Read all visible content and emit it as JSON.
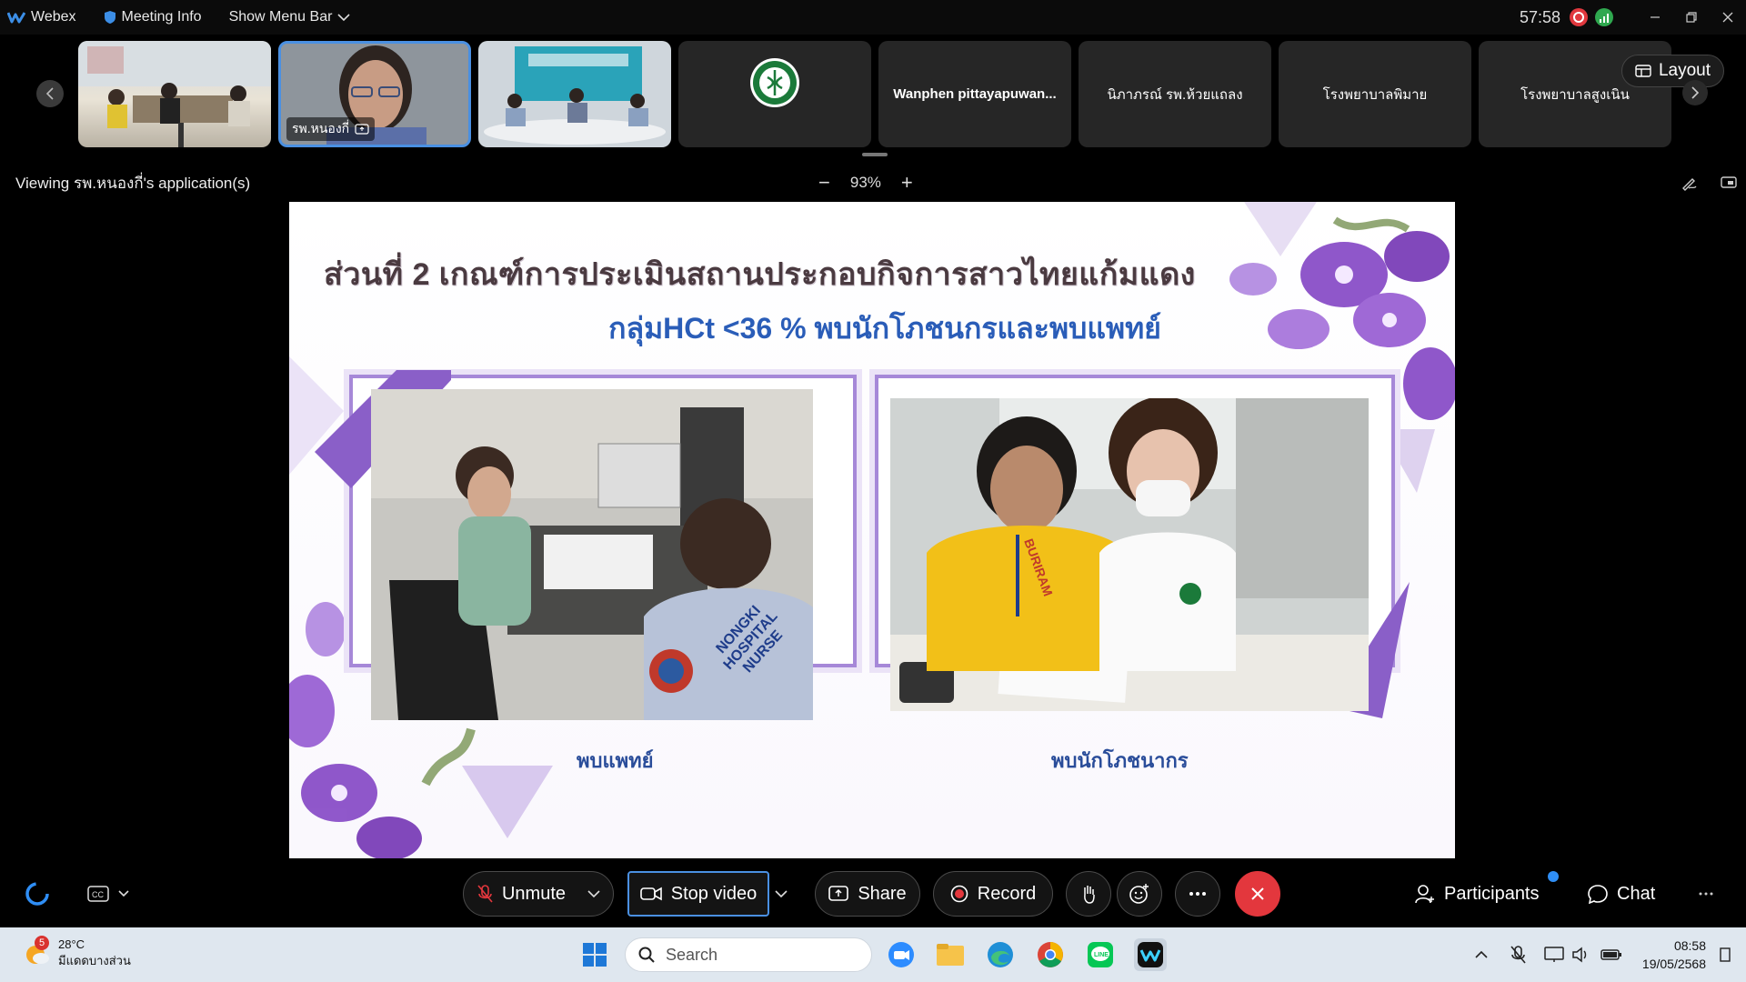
{
  "titlebar": {
    "app_name": "Webex",
    "meeting_info": "Meeting Info",
    "show_menu_bar": "Show Menu Bar",
    "timer": "57:58",
    "colors": {
      "webex_blue": "#3c8ee6",
      "record_red": "#e0383e",
      "stats_green": "#2fa84f"
    }
  },
  "filmstrip": {
    "participants": [
      {
        "name": "",
        "type": "video"
      },
      {
        "name": "รพ.หนองกี่",
        "type": "video",
        "active": true
      },
      {
        "name": "",
        "type": "video"
      },
      {
        "name": "",
        "type": "logo"
      },
      {
        "name": "Wanphen pittayapuwan...",
        "type": "name"
      },
      {
        "name": "นิภาภรณ์ รพ.ห้วยแถลง",
        "type": "name"
      },
      {
        "name": "โรงพยาบาลพิมาย",
        "type": "name"
      },
      {
        "name": "โรงพยาบาลสูงเนิน",
        "type": "name"
      }
    ],
    "layout_label": "Layout"
  },
  "viewbar": {
    "viewing_text": "Viewing รพ.หนองกี่'s application(s)",
    "zoom_level": "93%"
  },
  "slide": {
    "title": "ส่วนที่ 2 เกณฑ์การประเมินสถานประกอบกิจการสาวไทยแก้มแดง",
    "subtitle": "กลุ่มHCt <36 % พบนักโภชนกรและพบแพทย์",
    "left_caption": "พบแพทย์",
    "right_caption": "พบนักโภชนากร",
    "left_photo_text": "NONGKI HOSPITAL NURSE",
    "right_photo_text": "BURIRAM",
    "colors": {
      "frame": "#a688d8",
      "title": "#4a3a40",
      "subtitle": "#2a5db8",
      "caption": "#2a4d9a"
    }
  },
  "controls": {
    "unmute": "Unmute",
    "stop_video": "Stop video",
    "share": "Share",
    "record": "Record",
    "participants": "Participants",
    "chat": "Chat",
    "end_color": "#e3373d"
  },
  "taskbar": {
    "weather_badge": "5",
    "temperature": "28°C",
    "weather_desc": "มีแดดบางส่วน",
    "search_placeholder": "Search",
    "time": "08:58",
    "date": "19/05/2568"
  }
}
